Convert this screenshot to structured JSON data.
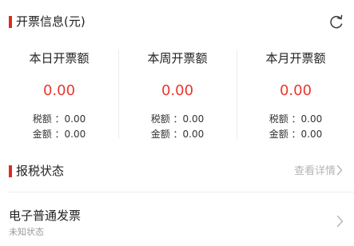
{
  "invoice_info": {
    "title": "开票信息(元)",
    "refresh_icon": "refresh-icon",
    "stats": [
      {
        "label": "本日开票额",
        "amount": "0.00",
        "tax_line": "税额 ：0.00",
        "gold_line": "金额 ：0.00"
      },
      {
        "label": "本周开票额",
        "amount": "0.00",
        "tax_line": "税额 ：0.00",
        "gold_line": "金额 ：0.00"
      },
      {
        "label": "本月开票额",
        "amount": "0.00",
        "tax_line": "税额 ：0.00",
        "gold_line": "金额 ：0.00"
      }
    ]
  },
  "tax_status": {
    "title": "报税状态",
    "view_details": "查看详情",
    "items": [
      {
        "name": "电子普通发票",
        "status": "未知状态"
      }
    ]
  },
  "colors": {
    "accent": "#d92d20",
    "amount": "#e8382f",
    "muted": "#b5b5b5"
  }
}
